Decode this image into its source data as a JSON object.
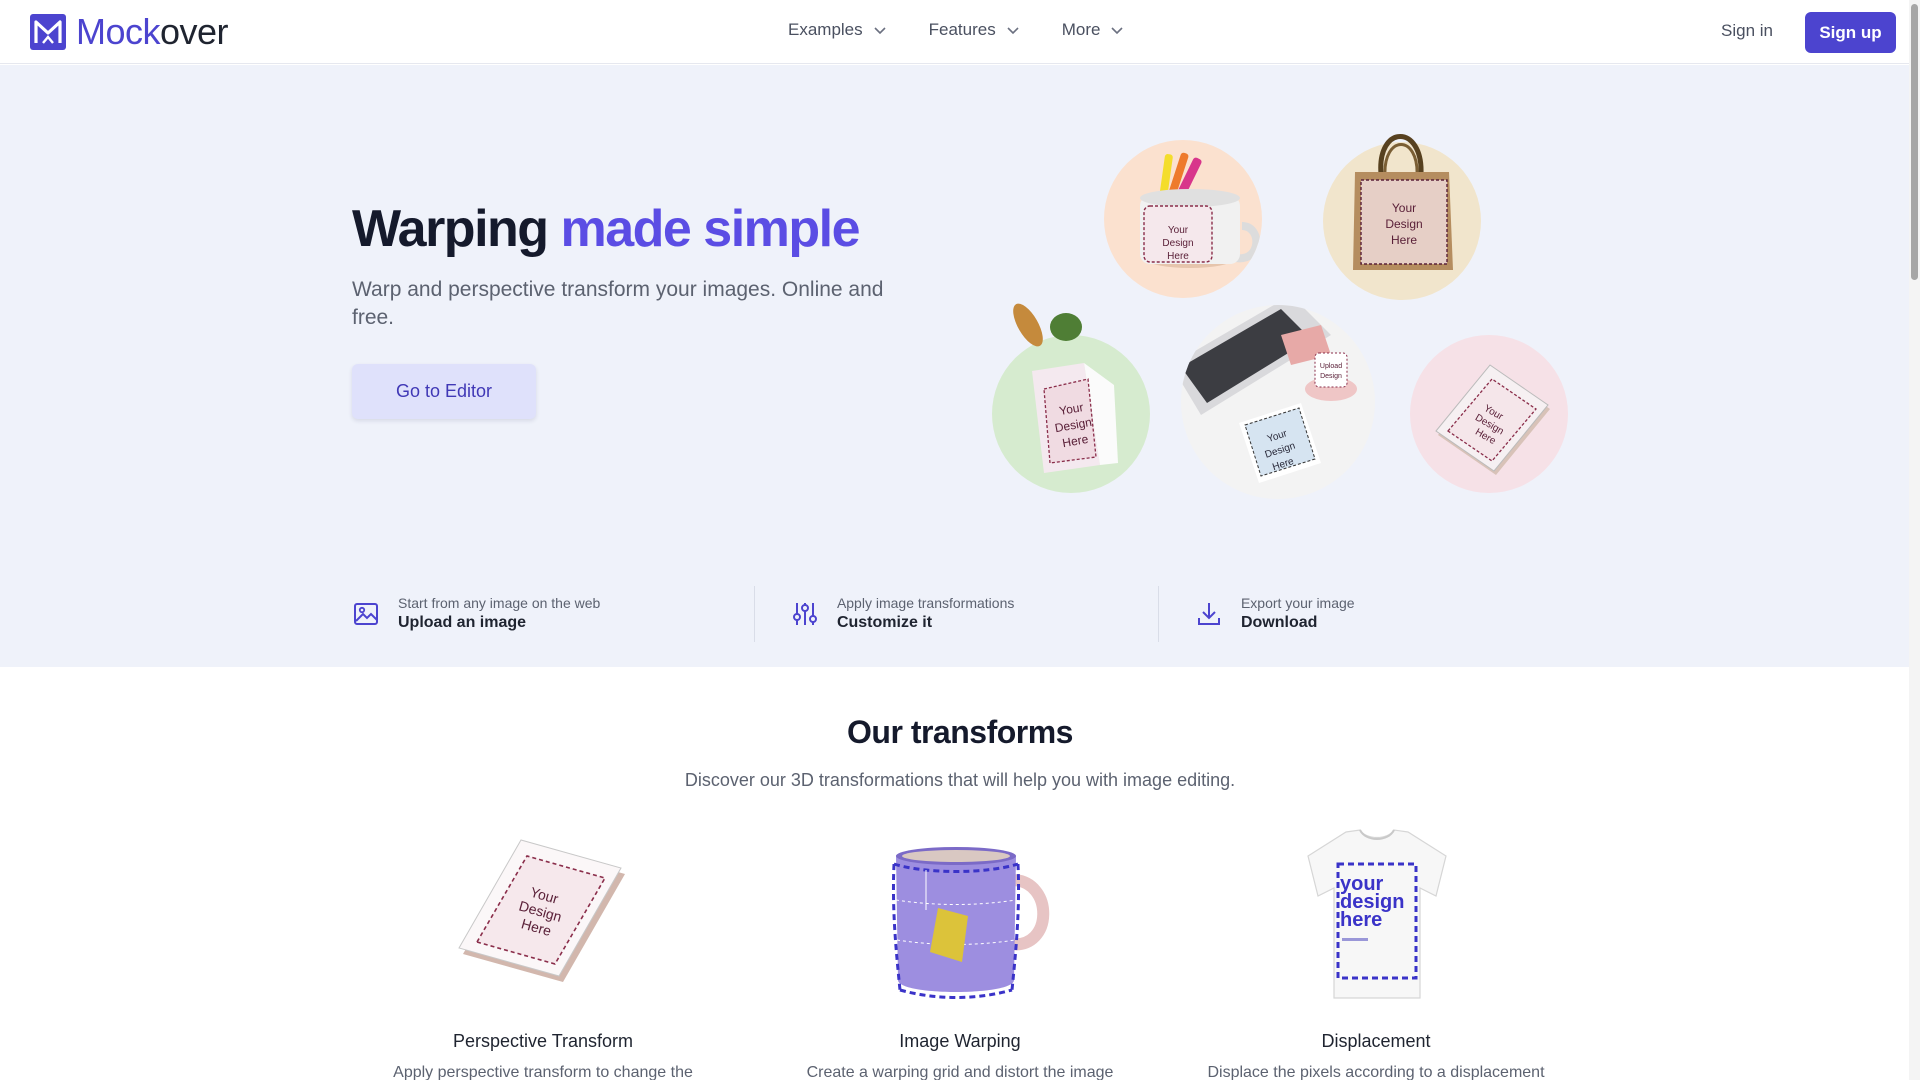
{
  "header": {
    "logo_part1": "Mock",
    "logo_part2": "over",
    "nav": [
      {
        "label": "Examples"
      },
      {
        "label": "Features"
      },
      {
        "label": "More"
      }
    ],
    "signin_label": "Sign in",
    "signup_label": "Sign up"
  },
  "hero": {
    "title_plain": "Warping ",
    "title_accent": "made simple",
    "subtitle": "Warp and perspective transform your images. Online and free.",
    "cta_label": "Go to Editor",
    "mockup_text": {
      "mug": "Your Design Here",
      "tote": "Your Design Here",
      "bag": "Your Design Here",
      "desk_card": "Your Design Here",
      "desk_mug": "Upload Design",
      "notepad": "Your Design Here"
    },
    "steps": [
      {
        "small": "Start from any image on the web",
        "big": "Upload an image",
        "icon": "image-icon"
      },
      {
        "small": "Apply image transformations",
        "big": "Customize it",
        "icon": "sliders-icon"
      },
      {
        "small": "Export your image",
        "big": "Download",
        "icon": "download-icon"
      }
    ]
  },
  "transforms": {
    "title": "Our transforms",
    "subtitle": "Discover our 3D transformations that will help you with image editing.",
    "cards": [
      {
        "title": "Perspective Transform",
        "desc": "Apply perspective transform to change the",
        "art_text": "Your Design Here"
      },
      {
        "title": "Image Warping",
        "desc": "Create a warping grid and distort the image",
        "art_text": ""
      },
      {
        "title": "Displacement",
        "desc": "Displace the pixels according to a displacement",
        "art_text": "your design here"
      }
    ]
  },
  "colors": {
    "brand": "#4c44cf",
    "accent": "#5b4de4",
    "hero_bg": "#eff2fa"
  }
}
